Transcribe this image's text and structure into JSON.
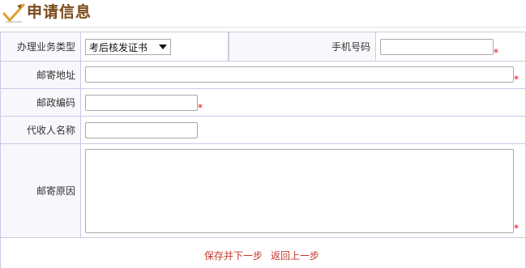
{
  "header": {
    "title": "申请信息",
    "icon": "pencil-check-icon"
  },
  "form": {
    "business_type": {
      "label": "办理业务类型",
      "selected": "考后核发证书"
    },
    "phone": {
      "label": "手机号码",
      "value": "",
      "required_mark": "*"
    },
    "mail_address": {
      "label": "邮寄地址",
      "value": "",
      "required_mark": "*"
    },
    "postal_code": {
      "label": "邮政编码",
      "value": "",
      "required_mark": "*"
    },
    "agent_name": {
      "label": "代收人名称",
      "value": ""
    },
    "mail_reason": {
      "label": "邮寄原因",
      "value": "",
      "required_mark": "*"
    }
  },
  "actions": {
    "save_next": "保存并下一步",
    "go_back": "返回上一步"
  },
  "colors": {
    "title": "#7a4a1a",
    "border": "#c9cbe4",
    "required": "#e0000f",
    "link": "#c0392b"
  }
}
